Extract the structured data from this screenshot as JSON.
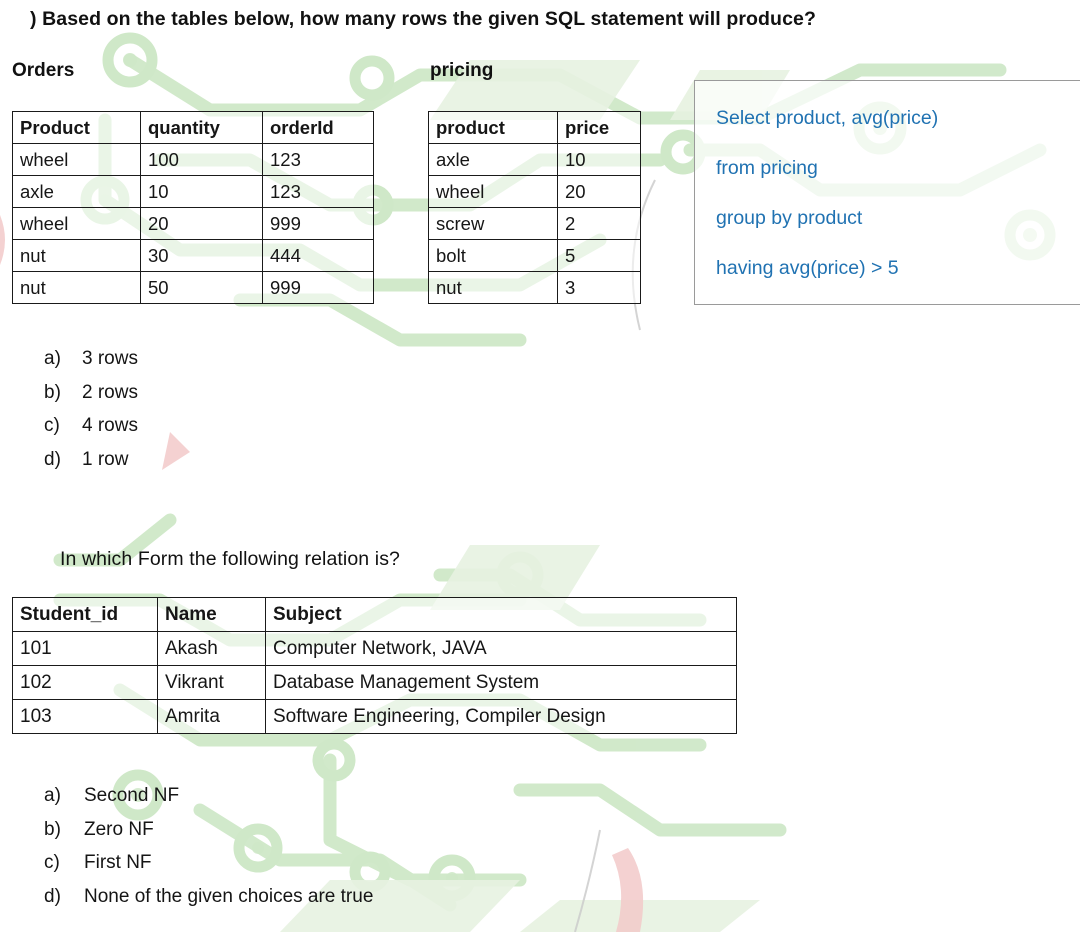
{
  "question1": {
    "prompt": ") Based on the tables below, how many rows the given SQL statement will produce?",
    "orders_table": {
      "title": "Orders",
      "headers": [
        "Product",
        "quantity",
        "orderId"
      ],
      "rows": [
        [
          "wheel",
          "100",
          "123"
        ],
        [
          "axle",
          "10",
          "123"
        ],
        [
          "wheel",
          "20",
          "999"
        ],
        [
          "nut",
          "30",
          "444"
        ],
        [
          "nut",
          "50",
          "999"
        ]
      ]
    },
    "pricing_table": {
      "title": "pricing",
      "headers": [
        "product",
        "price"
      ],
      "rows": [
        [
          "axle",
          "10"
        ],
        [
          "wheel",
          "20"
        ],
        [
          "screw",
          "2"
        ],
        [
          "bolt",
          "5"
        ],
        [
          "nut",
          "3"
        ]
      ]
    },
    "sql_statement": {
      "lines": [
        "Select product, avg(price)",
        "from pricing",
        "group by product",
        "having avg(price) > 5"
      ],
      "text_color": "#2072b2",
      "border_color": "#9a9a9a"
    },
    "options": [
      {
        "key": "a)",
        "label": "3 rows"
      },
      {
        "key": "b)",
        "label": "2 rows"
      },
      {
        "key": "c)",
        "label": "4 rows"
      },
      {
        "key": "d)",
        "label": "1 row"
      }
    ]
  },
  "question2": {
    "prompt": "In which Form the following relation is?",
    "relation_table": {
      "headers": [
        "Student_id",
        "Name",
        "Subject"
      ],
      "rows": [
        [
          "101",
          "Akash",
          "Computer Network, JAVA"
        ],
        [
          "102",
          "Vikrant",
          "Database Management System"
        ],
        [
          "103",
          "Amrita",
          "Software Engineering, Compiler Design"
        ]
      ]
    },
    "options": [
      {
        "key": "a)",
        "label": "Second NF"
      },
      {
        "key": "b)",
        "label": "Zero NF"
      },
      {
        "key": "c)",
        "label": "First NF"
      },
      {
        "key": "d)",
        "label": "None of the given choices are true"
      }
    ]
  },
  "theme": {
    "background": "#ffffff",
    "text_color": "#1a1a1a",
    "table_border": "#1a1a1a",
    "watermark_green": "#cfe8c8",
    "watermark_pink": "#f2c9c9"
  }
}
